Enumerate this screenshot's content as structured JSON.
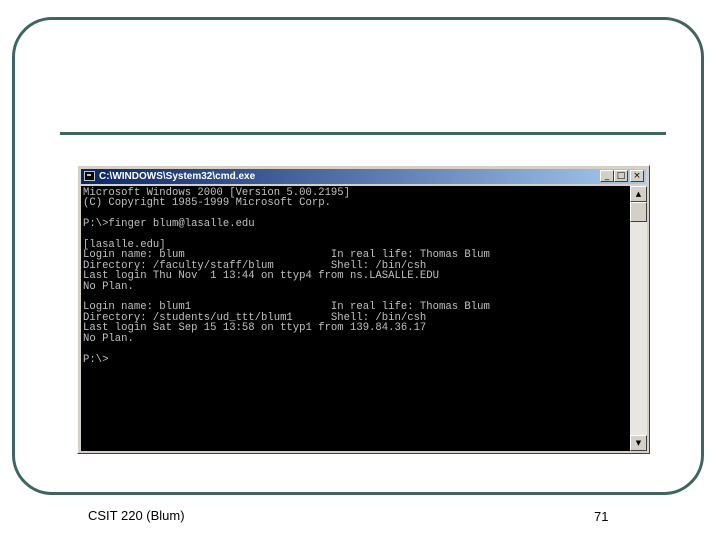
{
  "window": {
    "title": "C:\\WINDOWS\\System32\\cmd.exe",
    "minimize_glyph": "_",
    "maximize_glyph": "□",
    "close_glyph": "×"
  },
  "console": {
    "lines": [
      "Microsoft Windows 2000 [Version 5.00.2195]",
      "(C) Copyright 1985-1999 Microsoft Corp.",
      "",
      "P:\\>finger blum@lasalle.edu",
      "",
      "[lasalle.edu]",
      "Login name: blum                       In real life: Thomas Blum",
      "Directory: /faculty/staff/blum         Shell: /bin/csh",
      "Last login Thu Nov  1 13:44 on ttyp4 from ns.LASALLE.EDU",
      "No Plan.",
      "",
      "Login name: blum1                      In real life: Thomas Blum",
      "Directory: /students/ud_ttt/blum1      Shell: /bin/csh",
      "Last login Sat Sep 15 13:58 on ttyp1 from 139.84.36.17",
      "No Plan.",
      "",
      "P:\\>"
    ],
    "text_color": "#c0c0c0",
    "background": "#000000"
  },
  "scrollbar": {
    "up_glyph": "▲",
    "down_glyph": "▼"
  },
  "footer": {
    "course": "CSIT 220 (Blum)",
    "page_number": "71"
  },
  "colors": {
    "frame": "#3f6560",
    "titlebar_start": "#0a246a",
    "titlebar_end": "#a6caf0"
  }
}
